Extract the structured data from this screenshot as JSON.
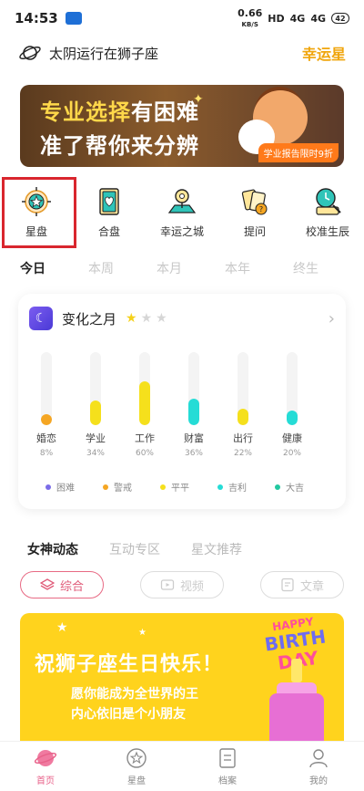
{
  "status_bar": {
    "time": "14:53",
    "net_speed": "0.66",
    "net_unit": "KB/S",
    "hd": "HD",
    "net1": "4G",
    "net2": "4G",
    "battery": "42"
  },
  "header": {
    "transit_text": "太阴运行在狮子座",
    "lucky_star": "幸运星"
  },
  "banner": {
    "line1_a": "专业选择",
    "line1_b": "有困难",
    "line2": "准了帮你来分辨",
    "chip": "学业报告限时9折"
  },
  "quick_menu": [
    {
      "label": "星盘",
      "icon": "star-chart-icon"
    },
    {
      "label": "合盘",
      "icon": "heart-card-icon"
    },
    {
      "label": "幸运之城",
      "icon": "city-map-icon"
    },
    {
      "label": "提问",
      "icon": "tarot-ask-icon"
    },
    {
      "label": "校准生辰",
      "icon": "clock-search-icon"
    }
  ],
  "period_tabs": [
    "今日",
    "本周",
    "本月",
    "本年",
    "终生"
  ],
  "fortune": {
    "title": "变化之月",
    "rating": 1,
    "rating_max": 3,
    "items": [
      {
        "name": "婚恋",
        "pct": "8%",
        "value": 0.08,
        "color": "#f5a623"
      },
      {
        "name": "学业",
        "pct": "34%",
        "value": 0.34,
        "color": "#f5e01c"
      },
      {
        "name": "工作",
        "pct": "60%",
        "value": 0.6,
        "color": "#f5e01c"
      },
      {
        "name": "财富",
        "pct": "36%",
        "value": 0.36,
        "color": "#25dcd6"
      },
      {
        "name": "出行",
        "pct": "22%",
        "value": 0.22,
        "color": "#f5e01c"
      },
      {
        "name": "健康",
        "pct": "20%",
        "value": 0.2,
        "color": "#25dcd6"
      }
    ],
    "legend": [
      {
        "name": "困难",
        "color": "#7b6ce8"
      },
      {
        "name": "警戒",
        "color": "#f5a623"
      },
      {
        "name": "平平",
        "color": "#f5e01c"
      },
      {
        "name": "吉利",
        "color": "#25dcd6"
      },
      {
        "name": "大吉",
        "color": "#22c8a0"
      }
    ]
  },
  "news_tabs": [
    "女神动态",
    "互动专区",
    "星文推荐"
  ],
  "chips": [
    {
      "label": "综合",
      "active": true
    },
    {
      "label": "视频",
      "active": false
    },
    {
      "label": "文章",
      "active": false
    }
  ],
  "birthday": {
    "title": "祝狮子座生日快乐！",
    "line1": "愿你能成为全世界的王",
    "line2": "内心依旧是个小朋友",
    "happy": "HAPPY",
    "birth": "BIRTH",
    "day": "DAY"
  },
  "bottom_nav": [
    {
      "label": "首页",
      "active": true
    },
    {
      "label": "星盘",
      "active": false
    },
    {
      "label": "档案",
      "active": false
    },
    {
      "label": "我的",
      "active": false
    }
  ]
}
